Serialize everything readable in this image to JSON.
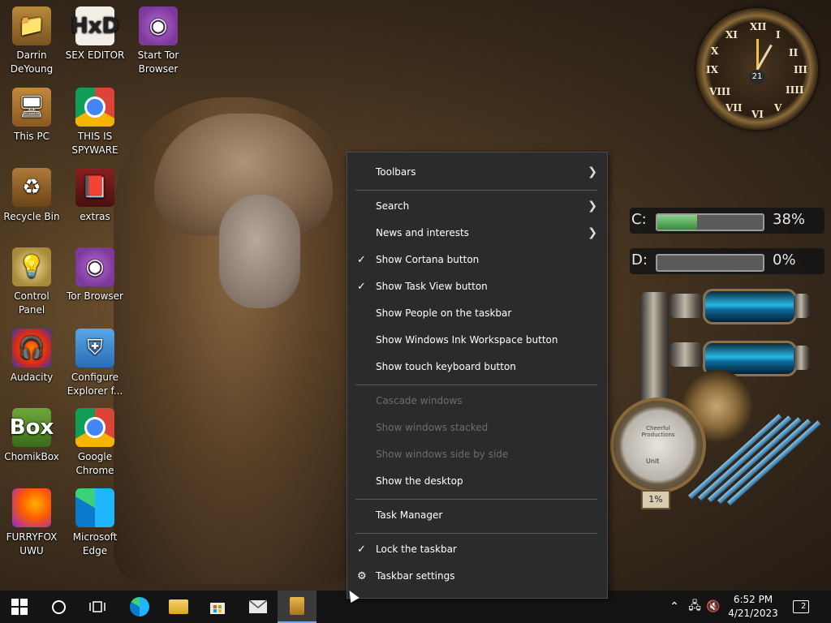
{
  "desktop_icons": [
    {
      "label": "Darrin DeYoung",
      "icon": "folder-icon"
    },
    {
      "label": "SEX EDITOR",
      "icon": "hxd-icon"
    },
    {
      "label": "Start Tor Browser",
      "icon": "tor-icon"
    },
    {
      "label": "This PC",
      "icon": "computer-icon"
    },
    {
      "label": "THIS IS SPYWARE",
      "icon": "chrome-icon"
    },
    {
      "label": "Recycle Bin",
      "icon": "recycle-bin-icon"
    },
    {
      "label": "extras",
      "icon": "folder-icon"
    },
    {
      "label": "Control Panel",
      "icon": "control-panel-icon"
    },
    {
      "label": "Tor Browser",
      "icon": "tor-icon"
    },
    {
      "label": "Audacity",
      "icon": "audacity-icon"
    },
    {
      "label": "Configure Explorer f...",
      "icon": "shield-icon"
    },
    {
      "label": "ChomikBox",
      "icon": "chomikbox-icon"
    },
    {
      "label": "Google Chrome",
      "icon": "chrome-icon"
    },
    {
      "label": "FURRYFOX UWU",
      "icon": "firefox-icon"
    },
    {
      "label": "Microsoft Edge",
      "icon": "edge-icon"
    }
  ],
  "clock_gadget": {
    "numerals": [
      "XII",
      "I",
      "II",
      "III",
      "IIII",
      "V",
      "VI",
      "VII",
      "VIII",
      "IX",
      "X",
      "XI"
    ],
    "date": "21"
  },
  "drives": [
    {
      "letter": "C:",
      "percent_text": "38%",
      "fill": 0.38
    },
    {
      "letter": "D:",
      "percent_text": "0%",
      "fill": 0.0
    }
  ],
  "gauge": {
    "title": "Cheerful Productions",
    "unit": "Unit",
    "badge": "1%"
  },
  "context_menu": {
    "toolbars": "Toolbars",
    "search": "Search",
    "news": "News and interests",
    "cortana": "Show Cortana button",
    "taskview": "Show Task View button",
    "people": "Show People on the taskbar",
    "ink": "Show Windows Ink Workspace button",
    "touch_kb": "Show touch keyboard button",
    "cascade": "Cascade windows",
    "stacked": "Show windows stacked",
    "side_by_side": "Show windows side by side",
    "show_desktop": "Show the desktop",
    "task_manager": "Task Manager",
    "lock": "Lock the taskbar",
    "settings": "Taskbar settings"
  },
  "taskbar": {
    "time": "6:52 PM",
    "date": "4/21/2023",
    "notifications_count": "2"
  }
}
